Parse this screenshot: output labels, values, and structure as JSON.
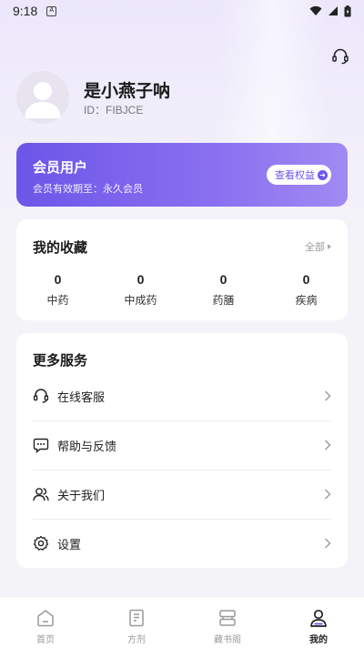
{
  "status_bar": {
    "time": "9:18",
    "notif_letter": "A"
  },
  "profile": {
    "username": "是小燕子呐",
    "user_id": "ID：FIBJCE"
  },
  "member": {
    "title": "会员用户",
    "expire": "会员有效期至：永久会员",
    "button": "查看权益"
  },
  "favorites": {
    "title": "我的收藏",
    "all_label": "全部",
    "stats": [
      {
        "count": "0",
        "label": "中药"
      },
      {
        "count": "0",
        "label": "中成药"
      },
      {
        "count": "0",
        "label": "药膳"
      },
      {
        "count": "0",
        "label": "疾病"
      }
    ]
  },
  "services": {
    "title": "更多服务",
    "items": [
      {
        "label": "在线客服",
        "icon": "headset-icon"
      },
      {
        "label": "帮助与反馈",
        "icon": "chat-icon"
      },
      {
        "label": "关于我们",
        "icon": "users-icon"
      },
      {
        "label": "设置",
        "icon": "gear-icon"
      }
    ]
  },
  "tabs": [
    {
      "label": "首页",
      "icon": "home-icon"
    },
    {
      "label": "方剂",
      "icon": "document-icon"
    },
    {
      "label": "藏书阁",
      "icon": "library-icon"
    },
    {
      "label": "我的",
      "icon": "profile-icon",
      "active": true
    }
  ],
  "colors": {
    "accent": "#6c56e8",
    "background": "#f4f4f8"
  }
}
